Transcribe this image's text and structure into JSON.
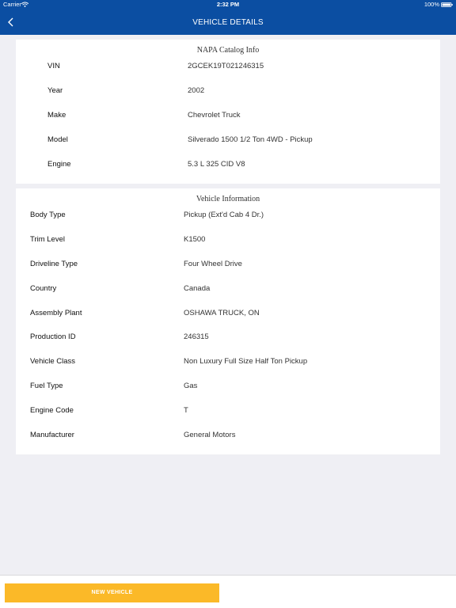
{
  "status_bar": {
    "carrier": "Carrier",
    "time": "2:32 PM",
    "battery": "100%"
  },
  "nav": {
    "title": "VEHICLE DETAILS",
    "back_icon": "chevron-left-icon"
  },
  "napa_catalog": {
    "title": "NAPA Catalog Info",
    "rows": [
      {
        "label": "VIN",
        "value": "2GCEK19T021246315"
      },
      {
        "label": "Year",
        "value": "2002"
      },
      {
        "label": "Make",
        "value": "Chevrolet Truck"
      },
      {
        "label": "Model",
        "value": "Silverado 1500 1/2 Ton 4WD - Pickup"
      },
      {
        "label": "Engine",
        "value": "5.3 L 325 CID V8"
      }
    ]
  },
  "vehicle_information": {
    "title": "Vehicle Information",
    "rows": [
      {
        "label": "Body Type",
        "value": "Pickup (Ext'd Cab 4 Dr.)"
      },
      {
        "label": "Trim Level",
        "value": "K1500"
      },
      {
        "label": "Driveline Type",
        "value": "Four Wheel Drive"
      },
      {
        "label": "Country",
        "value": "Canada"
      },
      {
        "label": "Assembly Plant",
        "value": "OSHAWA TRUCK, ON"
      },
      {
        "label": "Production ID",
        "value": "246315"
      },
      {
        "label": "Vehicle Class",
        "value": "Non Luxury Full Size Half Ton Pickup"
      },
      {
        "label": "Fuel Type",
        "value": "Gas"
      },
      {
        "label": "Engine Code",
        "value": "T"
      },
      {
        "label": "Manufacturer",
        "value": "General Motors"
      }
    ]
  },
  "footer": {
    "new_vehicle_label": "NEW VEHICLE"
  },
  "colors": {
    "header": "#0b4ea2",
    "background": "#efeff4",
    "button": "#fbb928"
  }
}
